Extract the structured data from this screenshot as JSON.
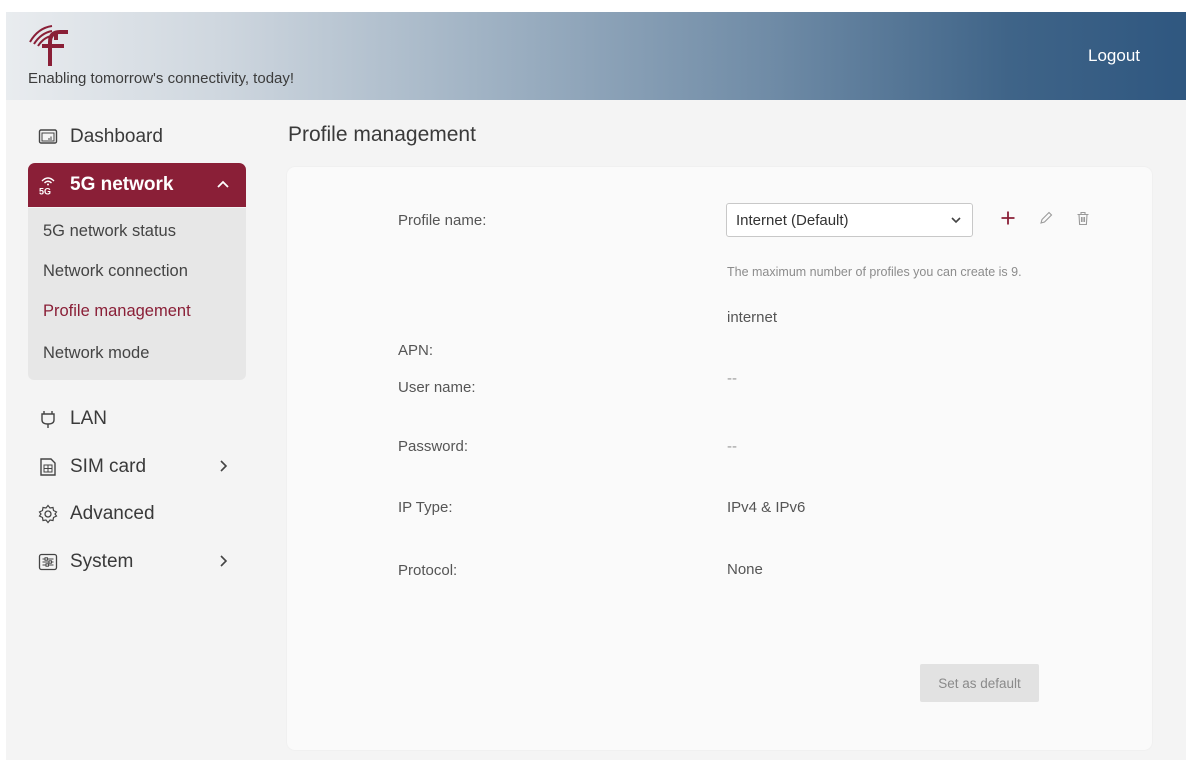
{
  "header": {
    "tagline": "Enabling tomorrow's connectivity, today!",
    "logout_label": "Logout",
    "logo_icon": "rf-logo-icon",
    "gradient_colors": [
      "#e9ecef",
      "#2f5780"
    ]
  },
  "sidebar": {
    "accent_color": "#8a1f37",
    "items": [
      {
        "label": "Dashboard",
        "icon": "dashboard-icon"
      },
      {
        "label": "5G network",
        "icon": "5g-signal-icon",
        "expanded": true
      },
      {
        "label": "LAN",
        "icon": "lan-plug-icon"
      },
      {
        "label": "SIM card",
        "icon": "sim-card-icon"
      },
      {
        "label": "Advanced",
        "icon": "gear-icon"
      },
      {
        "label": "System",
        "icon": "sliders-icon"
      }
    ],
    "submenu": [
      {
        "label": "5G network status"
      },
      {
        "label": "Network connection"
      },
      {
        "label": "Profile management",
        "active": true
      },
      {
        "label": "Network mode"
      }
    ]
  },
  "main": {
    "title": "Profile management",
    "form": {
      "profile_name_label": "Profile name:",
      "profile_selected": "Internet (Default)",
      "max_hint": "The maximum number of profiles you can create is 9.",
      "apn_label": "APN:",
      "apn_value": "internet",
      "username_label": "User name:",
      "username_value": "--",
      "password_label": "Password:",
      "password_value": "--",
      "iptype_label": "IP Type:",
      "iptype_value": "IPv4 & IPv6",
      "protocol_label": "Protocol:",
      "protocol_value": "None"
    },
    "actions": {
      "add_icon": "plus-icon",
      "edit_icon": "pencil-icon",
      "delete_icon": "trash-icon"
    },
    "set_default_label": "Set as default"
  }
}
